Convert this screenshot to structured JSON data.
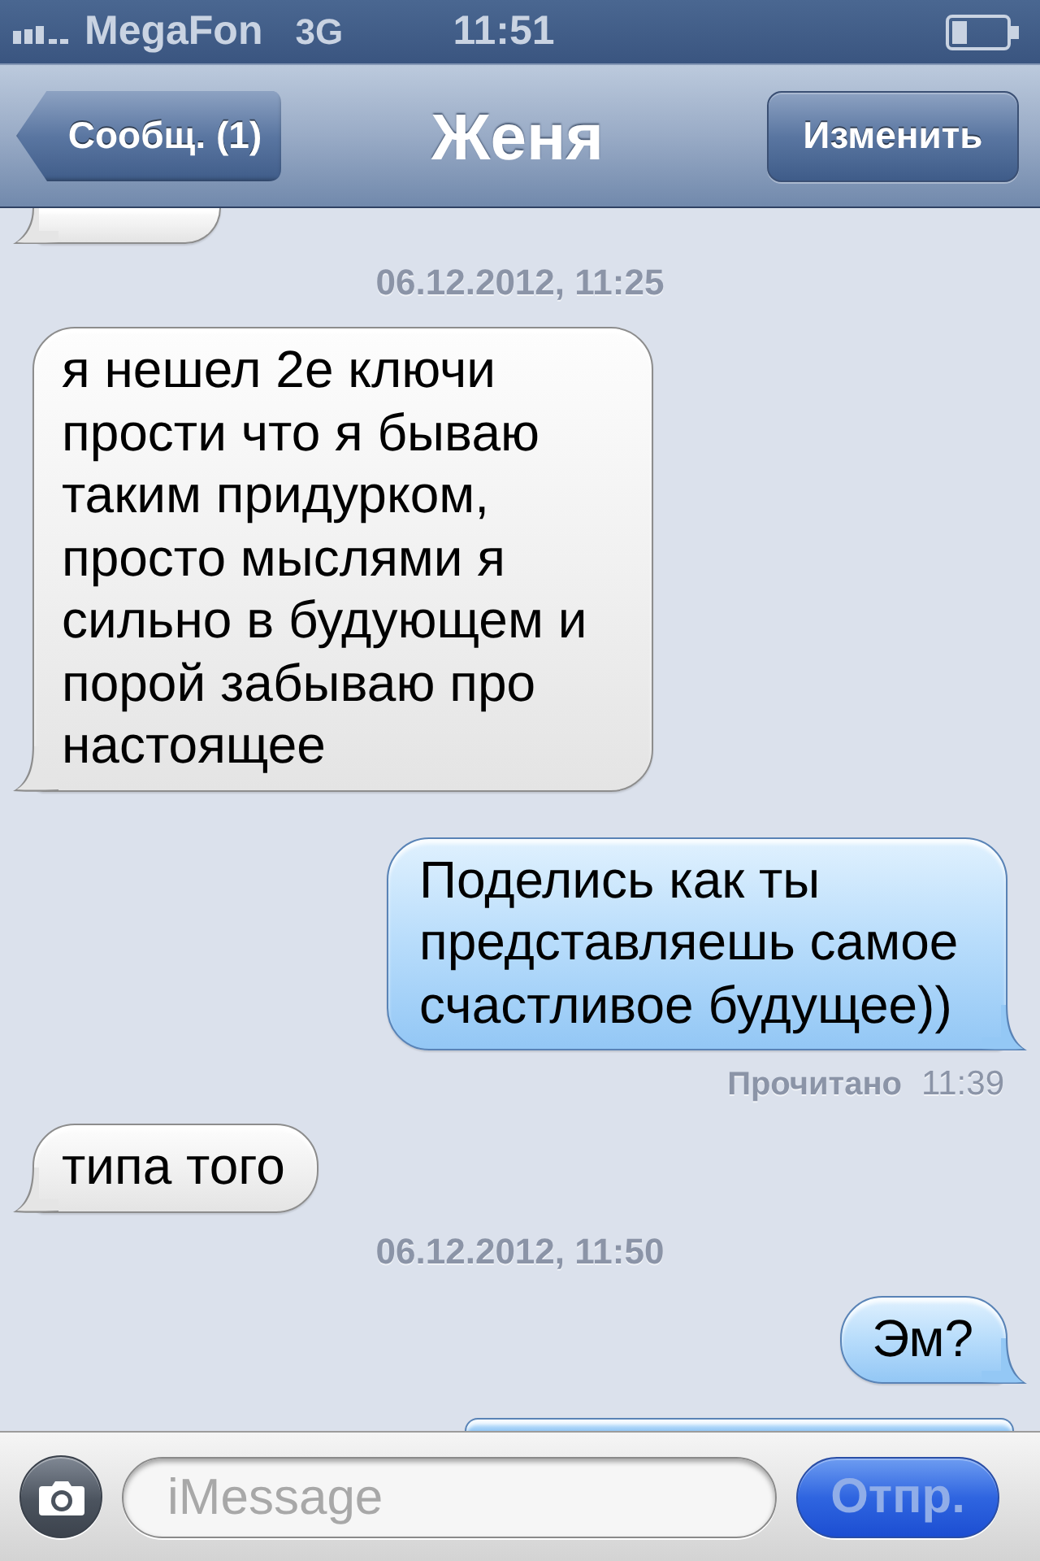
{
  "status_bar": {
    "carrier": "MegaFon",
    "network": "3G",
    "time": "11:51"
  },
  "nav_bar": {
    "back_button": "Сообщ. (1)",
    "title": "Женя",
    "edit_button": "Изменить"
  },
  "messages": [
    {
      "kind": "incoming",
      "clipped": true
    },
    {
      "kind": "timestamp",
      "text": "06.12.2012, 11:25"
    },
    {
      "kind": "incoming",
      "clipped": false,
      "text": "я нешел 2е ключи прости что я бываю таким придурком, просто мыслями я сильно в будующем и порой забываю про настоящее"
    },
    {
      "kind": "outgoing",
      "clipped": false,
      "text": "Поделись как ты представляешь самое счастливое будущее))"
    },
    {
      "kind": "receipt",
      "label": "Прочитано",
      "time": "11:39"
    },
    {
      "kind": "incoming",
      "clipped": false,
      "text": "типа того"
    },
    {
      "kind": "timestamp",
      "text": "06.12.2012, 11:50"
    },
    {
      "kind": "outgoing",
      "clipped": false,
      "text": "Эм?"
    },
    {
      "kind": "outgoing",
      "clipped": true
    }
  ],
  "compose_bar": {
    "placeholder": "iMessage",
    "send_button": {
      "label": "Отпр.",
      "disabled": true
    }
  }
}
